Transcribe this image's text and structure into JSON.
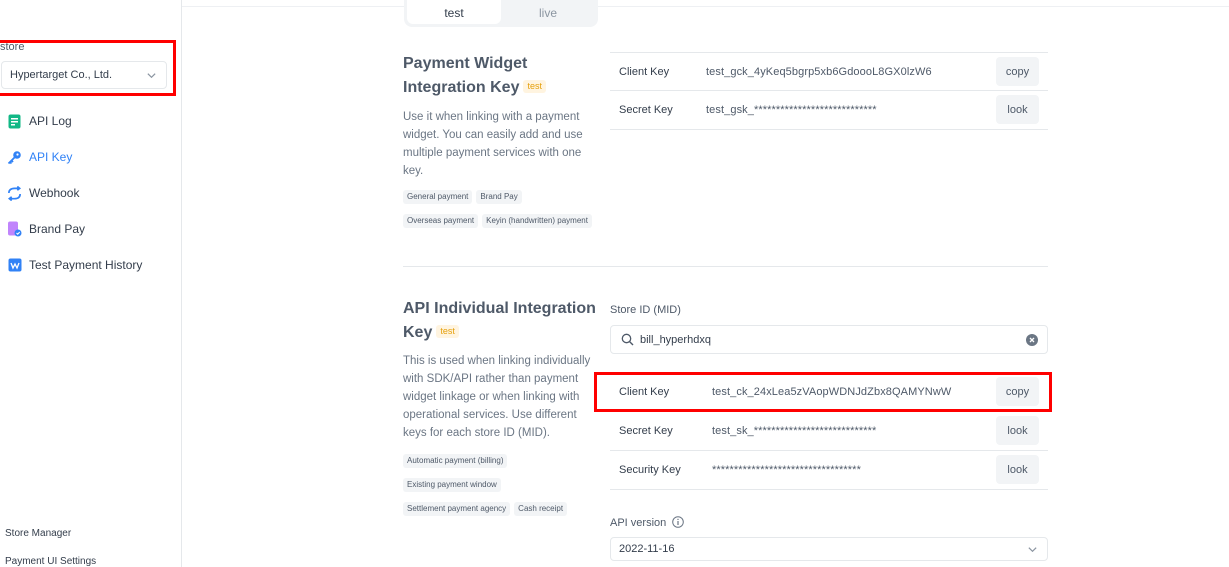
{
  "sidebar": {
    "store_label": "store",
    "store_value": "Hypertarget Co., Ltd.",
    "items": [
      {
        "label": "API Log",
        "icon": "document-icon",
        "color": "#12b886"
      },
      {
        "label": "API Key",
        "icon": "key-icon",
        "color": "#3182f6",
        "active": true
      },
      {
        "label": "Webhook",
        "icon": "refresh-icon",
        "color": "#3182f6"
      },
      {
        "label": "Brand Pay",
        "icon": "brand-pay-icon",
        "color": "#c084fc"
      },
      {
        "label": "Test Payment History",
        "icon": "test-history-icon",
        "color": "#3182f6"
      }
    ],
    "bottom": {
      "store_manager": "Store Manager",
      "payment_ui_settings": "Payment UI Settings"
    }
  },
  "env_tabs": {
    "test": "test",
    "live": "live",
    "selected": "test"
  },
  "widget": {
    "title_line1": "Payment Widget",
    "title_line2": "Integration Key",
    "badge": "test",
    "description": "Use it when linking with a payment widget. You can easily add and use multiple payment services with one key.",
    "chips": [
      "General payment",
      "Brand Pay",
      "Overseas payment",
      "Keyin (handwritten) payment"
    ],
    "rows": [
      {
        "label": "Client Key",
        "value": "test_gck_4yKeq5bgrp5xb6GdoooL8GX0lzW6",
        "button": "copy"
      },
      {
        "label": "Secret Key",
        "value": "test_gsk_****************************",
        "button": "look"
      }
    ]
  },
  "individual": {
    "title_line1": "API Individual Integration",
    "title_line2": "Key",
    "badge": "test",
    "description": "This is used when linking individually with SDK/API rather than payment widget linkage or when linking with operational services. Use different keys for each store ID (MID).",
    "chips": [
      "Automatic payment (billing)",
      "Existing payment window",
      "Settlement payment agency",
      "Cash receipt"
    ],
    "mid_label": "Store ID (MID)",
    "mid_value": "bill_hyperhdxq",
    "rows": [
      {
        "label": "Client Key",
        "value": "test_ck_24xLea5zVAopWDNJdZbx8QAMYNwW",
        "button": "copy"
      },
      {
        "label": "Secret Key",
        "value": "test_sk_****************************",
        "button": "look"
      },
      {
        "label": "Security Key",
        "value": "**********************************",
        "button": "look"
      }
    ],
    "api_version_label": "API version",
    "api_version_value": "2022-11-16"
  },
  "colors": {
    "accent": "#3182f6",
    "highlight": "#ff0000",
    "badge": "#e5a00d"
  }
}
